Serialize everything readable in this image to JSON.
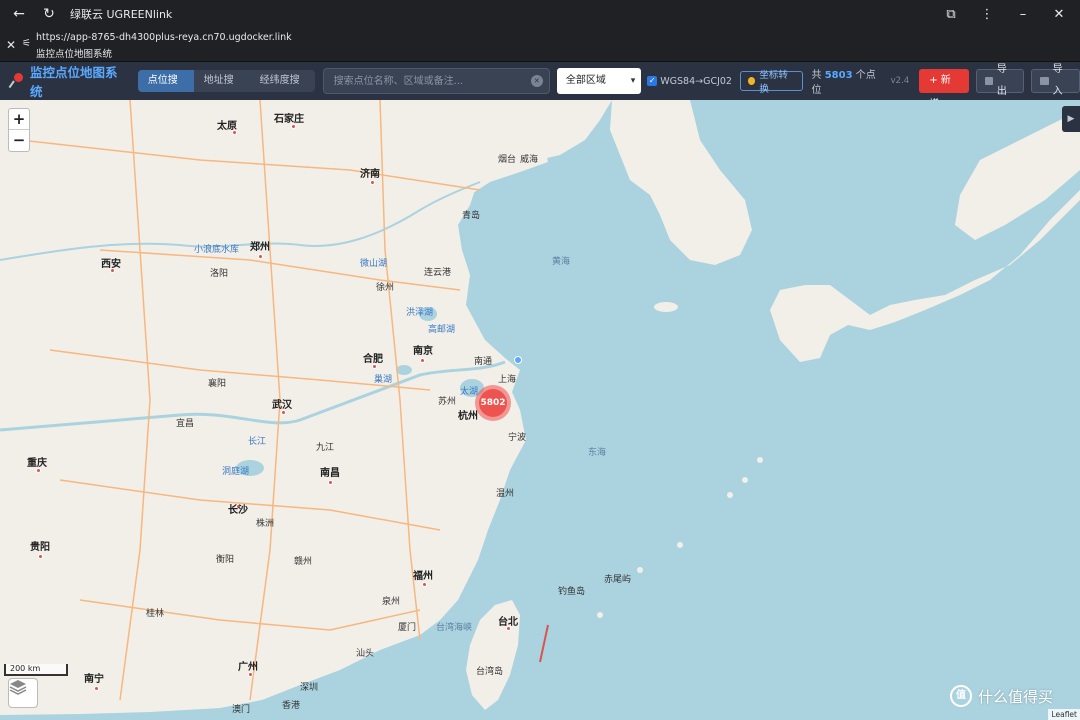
{
  "window": {
    "title": "绿联云 UGREENlink"
  },
  "browser": {
    "url": "https://app-8765-dh4300plus-reya.cn70.ugdocker.link",
    "page_title": "监控点位地图系统"
  },
  "app": {
    "name": "监控点位地图系统",
    "tabs": [
      {
        "label": "点位搜索",
        "active": true
      },
      {
        "label": "地址搜索",
        "active": false
      },
      {
        "label": "经纬度搜索",
        "active": false
      }
    ],
    "search_placeholder": "搜索点位名称、区域或备注...",
    "region_select": "全部区域",
    "coord_checkbox_label": "WGS84→GCJ02",
    "coord_checkbox_checked": true,
    "convert_button": "坐标转换",
    "count_prefix": "共",
    "count_value": "5803",
    "count_suffix": "个点位",
    "version": "v2.4",
    "add_button": "+ 新增",
    "export_button": "导出",
    "import_button": "导入"
  },
  "map": {
    "zoom_in": "+",
    "zoom_out": "−",
    "cluster_count": "5802",
    "scale": "200 km",
    "attribution": "Leaflet",
    "side_toggle": "▶",
    "watermark": "什么值得买",
    "watermark_logo": "值",
    "labels": {
      "taiyuan": "太原",
      "shijiazhuang": "石家庄",
      "jinan": "济南",
      "zhengzhou": "郑州",
      "xian": "西安",
      "hefei": "合肥",
      "nanjing": "南京",
      "shanghai": "上海",
      "hangzhou": "杭州",
      "wuhan": "武汉",
      "chongqing": "重庆",
      "changsha": "长沙",
      "nanchang": "南昌",
      "guiyang": "贵阳",
      "fuzhou": "福州",
      "guangzhou": "广州",
      "nanning": "南宁",
      "xianggang": "香港",
      "aomen": "澳门",
      "taibei": "台北",
      "yellow_sea": "黄海",
      "east_sea": "东海",
      "taiwan_strait": "台湾海峡",
      "taiwan_island": "台湾岛",
      "chiwei": "赤尾屿",
      "diaoyu": "钓鱼岛",
      "taihu": "太湖",
      "chaohu": "巢湖",
      "hongze": "洪泽湖",
      "gaoyou": "高邮湖",
      "weishan": "微山湖",
      "dongting": "洞庭湖",
      "xiaolangdi": "小浪底水库",
      "changjiang": "长江",
      "qingdao": "青岛",
      "yantai": "烟台",
      "weihai": "威海",
      "suzhou": "苏州",
      "ningbo": "宁波",
      "wenzhou": "温州",
      "xiamen": "厦门",
      "shantou": "汕头",
      "shenzhen": "深圳",
      "guilin": "桂林",
      "luoyang": "洛阳",
      "xiangyang": "襄阳",
      "yichang": "宜昌",
      "xuzhou": "徐州",
      "lianyungang": "连云港",
      "jiujiang": "九江",
      "ganzhou": "赣州",
      "quanzhou": "泉州",
      "hengyang": "衡阳",
      "zhuzhou": "株洲",
      "nantong": "南通"
    }
  }
}
